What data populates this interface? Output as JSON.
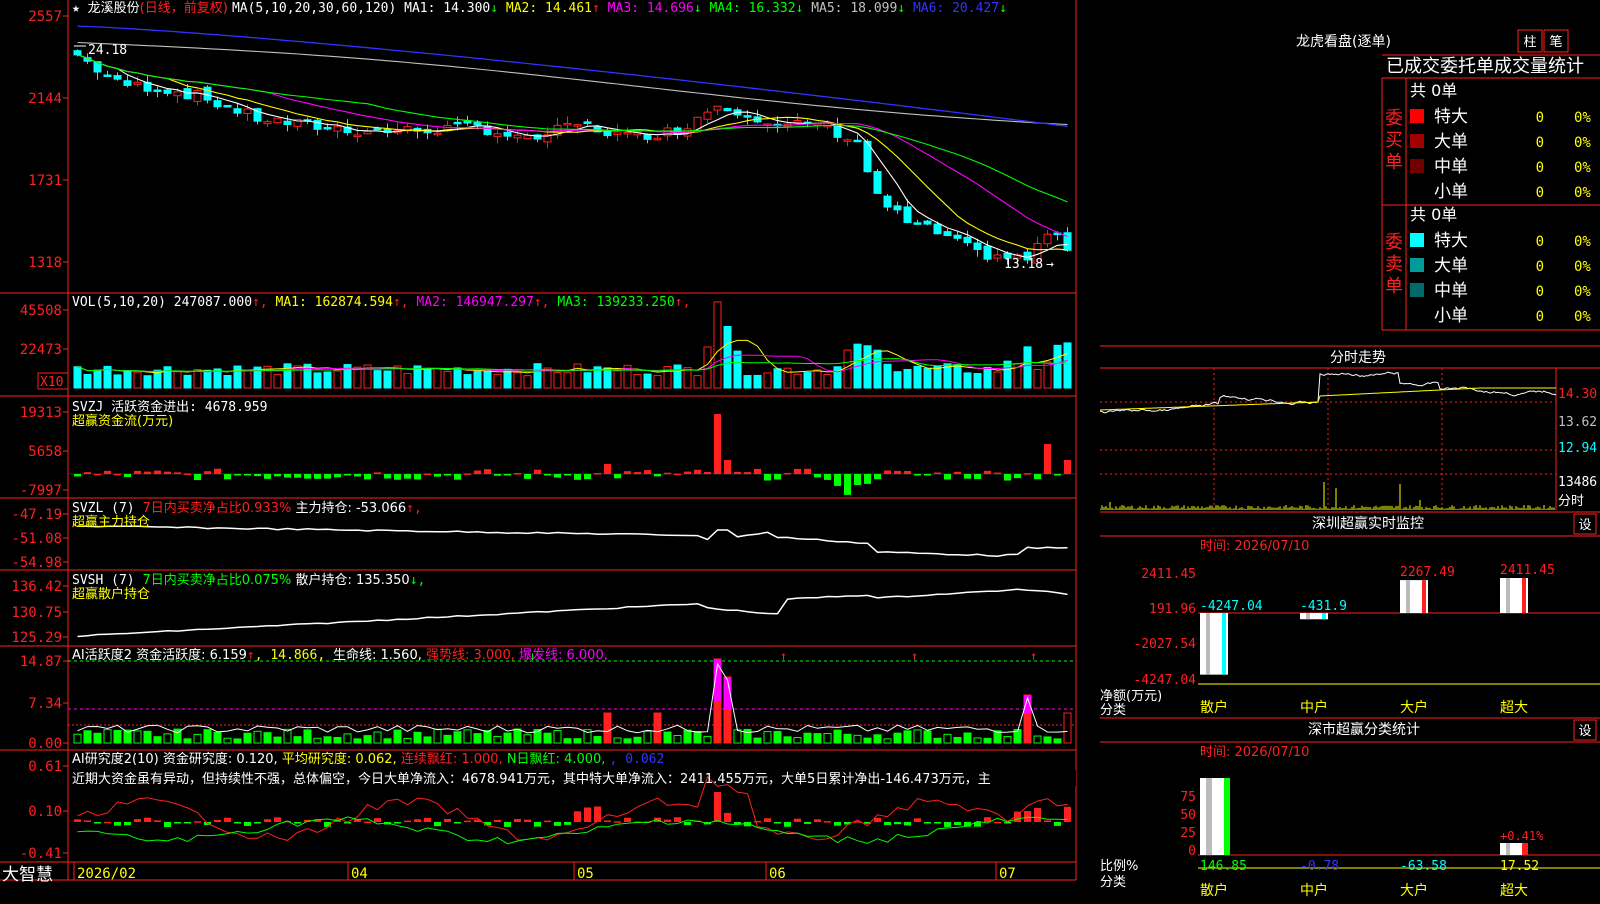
{
  "app_name": "大智慧",
  "stock": {
    "name": "龙溪股份",
    "mode": "(日线，前复权)"
  },
  "kline": {
    "ma_header": "MA(5,10,20,30,60,120)",
    "ma": [
      {
        "label": "MA1:",
        "value": "14.300",
        "arrow": "↓",
        "color": "#ffffff"
      },
      {
        "label": "MA2:",
        "value": "14.461",
        "arrow": "↑",
        "color": "#ffff00"
      },
      {
        "label": "MA3:",
        "value": "14.696",
        "arrow": "↓",
        "color": "#ff00ff"
      },
      {
        "label": "MA4:",
        "value": "16.332",
        "arrow": "↓",
        "color": "#00ff00"
      },
      {
        "label": "MA5:",
        "value": "18.099",
        "arrow": "↓",
        "color": "#c0c0c0"
      },
      {
        "label": "MA6:",
        "value": "20.427",
        "arrow": "↓",
        "color": "#3333ff"
      }
    ],
    "y_labels": [
      "2557",
      "2144",
      "1731",
      "1318"
    ],
    "high_label": "24.18",
    "low_label": "13.18",
    "low_arrow": "→"
  },
  "vol": {
    "header": "VOL(5,10,20)",
    "value": "247087.000",
    "ma": [
      {
        "label": "MA1:",
        "value": "162874.594",
        "color": "#ffff00"
      },
      {
        "label": "MA2:",
        "value": "146947.297",
        "color": "#ff00ff"
      },
      {
        "label": "MA3:",
        "value": "139233.250",
        "color": "#00ff00"
      }
    ],
    "y_labels": [
      "45508",
      "22473"
    ],
    "unit": "X10"
  },
  "svzj": {
    "line1": "SVZJ  活跃资金进出: 4678.959",
    "line2": "超赢资金流(万元)",
    "y_labels": [
      "19313",
      "5658",
      "-7997"
    ]
  },
  "svzl": {
    "prefix": "SVZL (7)",
    "ratio": "7日内买卖净占比0.933%",
    "hold": "主力持仓: -53.066",
    "line2": "超赢主力持仓",
    "y_labels": [
      "-47.19",
      "-51.08",
      "-54.98"
    ]
  },
  "svsh": {
    "prefix": "SVSH (7)",
    "ratio": "7日内买卖净占比0.075%",
    "hold": "散户持仓: 135.350",
    "line2": "超赢散户持仓",
    "y_labels": [
      "136.42",
      "130.75",
      "125.29"
    ]
  },
  "ai_active": {
    "t1": "AI活跃度2",
    "t2": "资金活跃度: 6.159",
    "t3": ", 14.866,",
    "t4": "生命线: 1.560,",
    "t5": "强势线: 3.000,",
    "t6": "爆发线: 6.000,",
    "y_labels": [
      "14.87",
      "7.34",
      "0.00"
    ]
  },
  "ai_research": {
    "t1": "AI研究度2(10)",
    "t2": "资金研究度: 0.120",
    "t3": "平均研究度: 0.062",
    "t4": "连续飘红: 1.000",
    "t5": "N日飘红: 4.000",
    "t6": ", 0.062",
    "desc": "近期大资金虽有异动，但持续性不强，总体偏空，今日大单净流入：4678.941万元，其中特大单净流入：2411.455万元，大单5日累计净出-146.473万元，主",
    "y_labels": [
      "0.61",
      "0.10",
      "-0.41"
    ]
  },
  "dates": [
    "2026/02",
    "04",
    "05",
    "06",
    "07"
  ],
  "right": {
    "title": "龙虎看盘(逐单)",
    "btn1": "柱",
    "btn2": "笔",
    "stats_title": "已成交委托单成交量统计",
    "buy_label": "委买单",
    "sell_label": "委卖单",
    "buy_total": "共 0单",
    "sell_total": "共 0单",
    "buy_rows": [
      {
        "name": "特大",
        "count": "0",
        "pct": "0%",
        "color": "#ff0000"
      },
      {
        "name": "大单",
        "count": "0",
        "pct": "0%",
        "color": "#a00000"
      },
      {
        "name": "中单",
        "count": "0",
        "pct": "0%",
        "color": "#700000"
      },
      {
        "name": "小单",
        "count": "0",
        "pct": "0%",
        "color": "#000000"
      }
    ],
    "sell_rows": [
      {
        "name": "特大",
        "count": "0",
        "pct": "0%",
        "color": "#00ffff"
      },
      {
        "name": "大单",
        "count": "0",
        "pct": "0%",
        "color": "#009a9a"
      },
      {
        "name": "中单",
        "count": "0",
        "pct": "0%",
        "color": "#006a6a"
      },
      {
        "name": "小单",
        "count": "0",
        "pct": "0%",
        "color": "#000000"
      }
    ],
    "intraday_title": "分时走势",
    "intraday_labels": [
      "14.30",
      "13.62",
      "12.94",
      "13486"
    ],
    "intraday_unit": "分时",
    "monitor_title": "深圳超赢实时监控",
    "settings_label": "设",
    "time_label": "时间: 2026/07/10",
    "monitor_y": [
      "2411.45",
      "191.96",
      "-2027.54",
      "-4247.04"
    ],
    "monitor_values": [
      "-4247.04",
      "-431.9",
      "2267.49",
      "2411.45"
    ],
    "net_label": "净额(万元)",
    "class_label": "分类",
    "categories": [
      "散户",
      "中户",
      "大户",
      "超大"
    ],
    "class_title": "深市超赢分类统计",
    "ratio_label": "比例%",
    "class_y": [
      "75",
      "50",
      "25",
      "0"
    ],
    "class_values": [
      "146.85",
      "-0.78",
      "-63.58",
      "17.52"
    ],
    "class_note": "+0.41%"
  }
}
